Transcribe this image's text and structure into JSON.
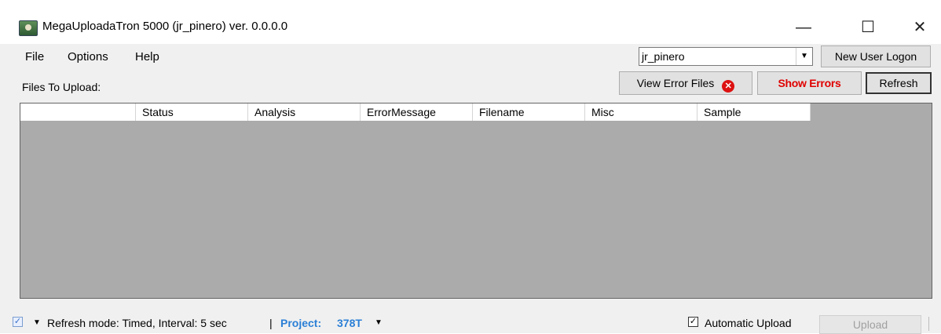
{
  "window": {
    "title": "MegaUploadaTron 5000 (jr_pinero) ver. 0.0.0.0",
    "minimize_glyph": "—",
    "maximize_glyph": "☐",
    "close_glyph": "✕"
  },
  "menu": {
    "file": "File",
    "options": "Options",
    "help": "Help"
  },
  "user": {
    "selected": "jr_pinero",
    "new_user_logon": "New User Logon"
  },
  "toolbar": {
    "files_to_upload": "Files To Upload:",
    "view_error_files": "View Error Files",
    "show_errors": "Show Errors",
    "refresh": "Refresh"
  },
  "grid": {
    "columns": [
      "",
      "Status",
      "Analysis",
      "ErrorMessage",
      "Filename",
      "Misc",
      "Sample"
    ]
  },
  "statusbar": {
    "refresh_mode": "Refresh mode: Timed, Interval: 5 sec",
    "separator": "|",
    "project_label": "Project:",
    "project_value": "378T",
    "auto_upload_label": "Automatic Upload",
    "upload": "Upload",
    "auto_upload_checked": true
  },
  "colors": {
    "show_errors_text": "#e00000",
    "project_text": "#2a7fd6",
    "grid_background": "#ababab"
  }
}
